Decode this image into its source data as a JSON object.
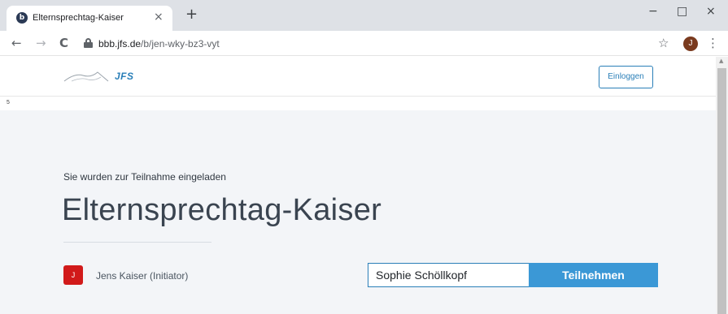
{
  "browser": {
    "tab_title": "Elternsprechtag-Kaiser",
    "tab_close": "×",
    "new_tab": "+",
    "url_host": "bbb.jfs.de",
    "url_path": "/b/jen-wky-bz3-vyt",
    "back": "←",
    "forward": "→",
    "reload": "C",
    "bookmark": "☆",
    "profile_initial": "J",
    "menu": "⋮",
    "minimize": "−",
    "maximize": "□",
    "close": "×",
    "favicon_letter": "b"
  },
  "header": {
    "logo_text": "JFS",
    "login_label": "Einloggen"
  },
  "strip_char": "5",
  "main": {
    "invite_text": "Sie wurden zur Teilnahme eingeladen",
    "room_title": "Elternsprechtag-Kaiser",
    "owner_initial": "J",
    "owner_name": "Jens Kaiser (Initiator)",
    "name_value": "Sophie Schöllkopf",
    "join_label": "Teilnehmen"
  },
  "icons": {
    "lock": "lock-icon",
    "logo": "mountain-logo-icon",
    "scroll_up": "▲"
  }
}
